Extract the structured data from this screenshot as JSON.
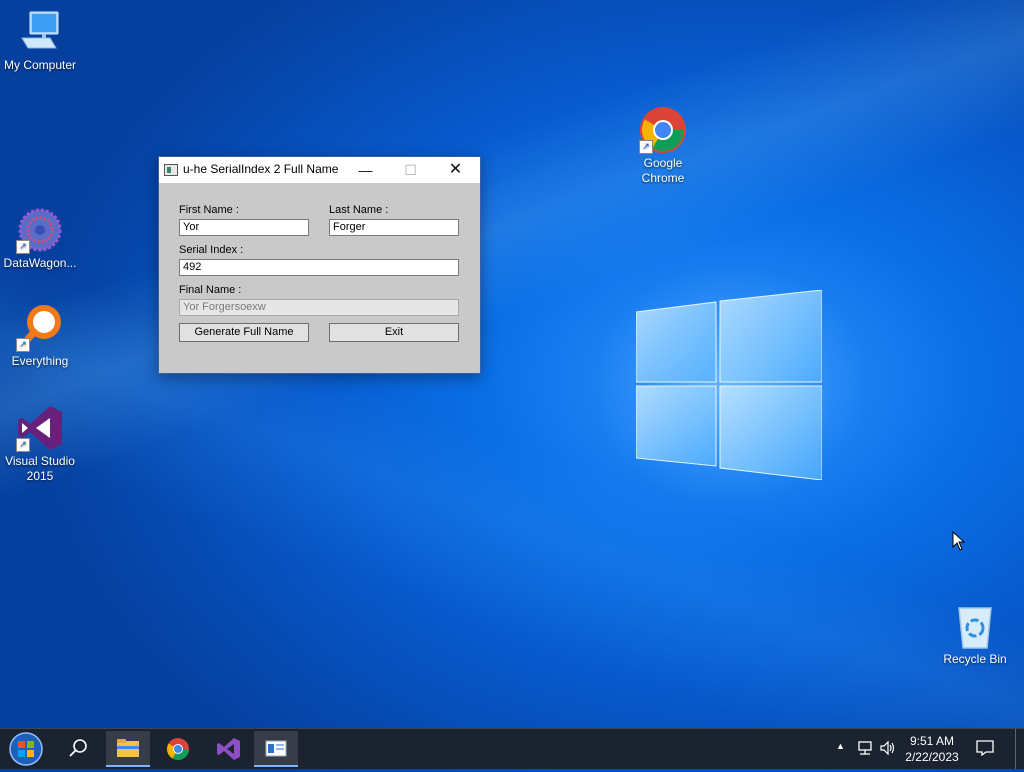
{
  "desktop": {
    "icons": [
      {
        "label": "My Computer",
        "icon": "computer-icon"
      },
      {
        "label": "DataWagon...",
        "icon": "datawagon-icon"
      },
      {
        "label": "Everything",
        "icon": "everything-search-icon"
      },
      {
        "label": "Visual Studio 2015",
        "icon": "visual-studio-icon"
      },
      {
        "label": "Google Chrome",
        "icon": "chrome-icon"
      },
      {
        "label": "Recycle Bin",
        "icon": "recycle-bin-icon"
      }
    ]
  },
  "window": {
    "title": "u-he SerialIndex 2 Full Name",
    "controls": {
      "minimize": "—",
      "maximize": "☐",
      "close": "✕"
    },
    "first_name_label": "First Name :",
    "first_name_value": "Yor",
    "last_name_label": "Last Name :",
    "last_name_value": "Forger",
    "serial_label": "Serial Index :",
    "serial_value": "492",
    "final_label": "Final Name :",
    "final_value": "Yor Forgersoexw",
    "generate_label": "Generate Full Name",
    "exit_label": "Exit"
  },
  "taskbar": {
    "items": [
      "start-button",
      "search-icon",
      "file-explorer-icon",
      "chrome-icon",
      "visual-studio-icon",
      "serialindex-app-icon"
    ],
    "tray": {
      "chevron": "▲",
      "network": "network-icon",
      "volume": "volume-icon"
    },
    "time": "9:51 AM",
    "date": "2/22/2023"
  },
  "colors": {
    "accent": "#0a6fe6",
    "taskbar": "#1b2330"
  }
}
